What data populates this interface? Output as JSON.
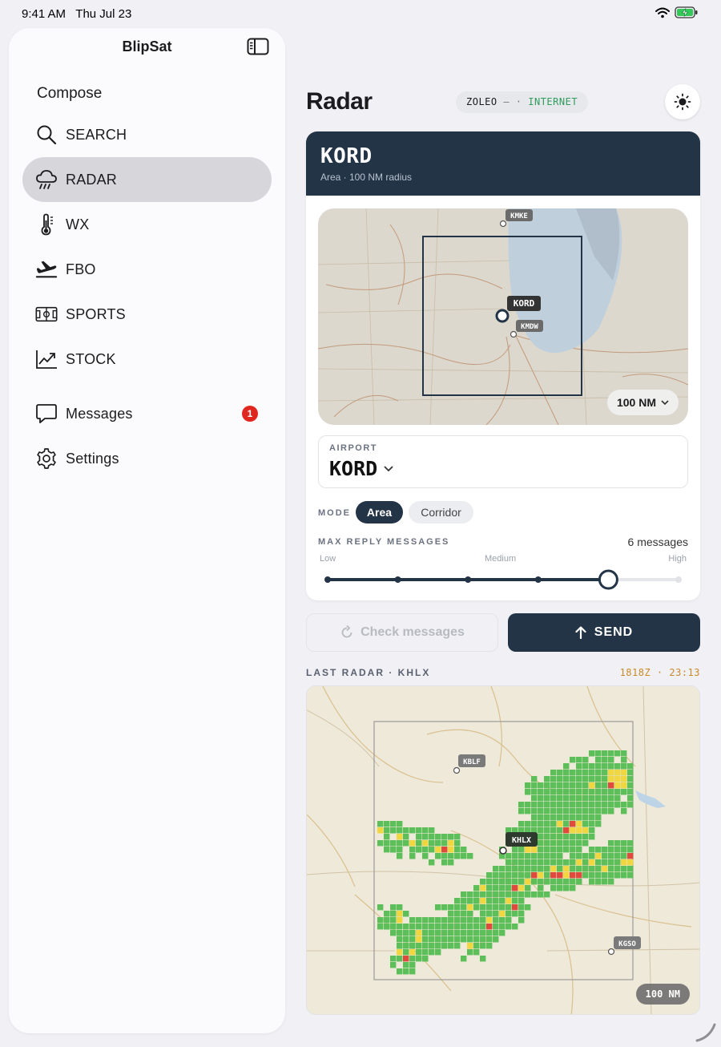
{
  "status_bar": {
    "time": "9:41 AM",
    "date": "Thu Jul 23"
  },
  "sidebar": {
    "title": "BlipSat",
    "compose_label": "Compose",
    "items": [
      {
        "label": "SEARCH",
        "icon": "search-icon",
        "active": false
      },
      {
        "label": "RADAR",
        "icon": "cloud-rain-icon",
        "active": true
      },
      {
        "label": "WX",
        "icon": "thermometer-icon",
        "active": false
      },
      {
        "label": "FBO",
        "icon": "plane-departure-icon",
        "active": false
      },
      {
        "label": "SPORTS",
        "icon": "field-icon",
        "active": false
      },
      {
        "label": "STOCK",
        "icon": "chart-up-icon",
        "active": false
      }
    ],
    "messages": {
      "label": "Messages",
      "badge": "1"
    },
    "settings": {
      "label": "Settings"
    }
  },
  "header": {
    "title": "Radar",
    "connection": {
      "device": "ZOLEO",
      "sep": " — · ",
      "network": "INTERNET"
    }
  },
  "card": {
    "code": "KORD",
    "subtitle": "Area · 100 NM radius",
    "map_labels": {
      "kmke": "KMKE",
      "kord": "KORD",
      "kmdw": "KMDW"
    },
    "range": "100 NM",
    "airport_label": "AIRPORT",
    "airport_value": "KORD",
    "mode_label": "MODE",
    "mode_options": [
      "Area",
      "Corridor"
    ],
    "mode_selected": "Area",
    "max_reply_label": "MAX REPLY MESSAGES",
    "max_reply_value": "6 messages",
    "scale": {
      "low": "Low",
      "medium": "Medium",
      "high": "High"
    },
    "slider": {
      "steps": 6,
      "selected": 4
    }
  },
  "actions": {
    "check_label": "Check messages",
    "send_label": "SEND"
  },
  "last_radar": {
    "label": "LAST RADAR · KHLX",
    "time": "1818Z  ·  23:13",
    "labels": {
      "kblf": "KBLF",
      "khlx": "KHLX",
      "kgso": "KGSO"
    },
    "range": "100 NM"
  },
  "colors": {
    "navy": "#243447",
    "badge": "#e0271f",
    "green": "#2f9d5e",
    "amber": "#c98a2a"
  }
}
